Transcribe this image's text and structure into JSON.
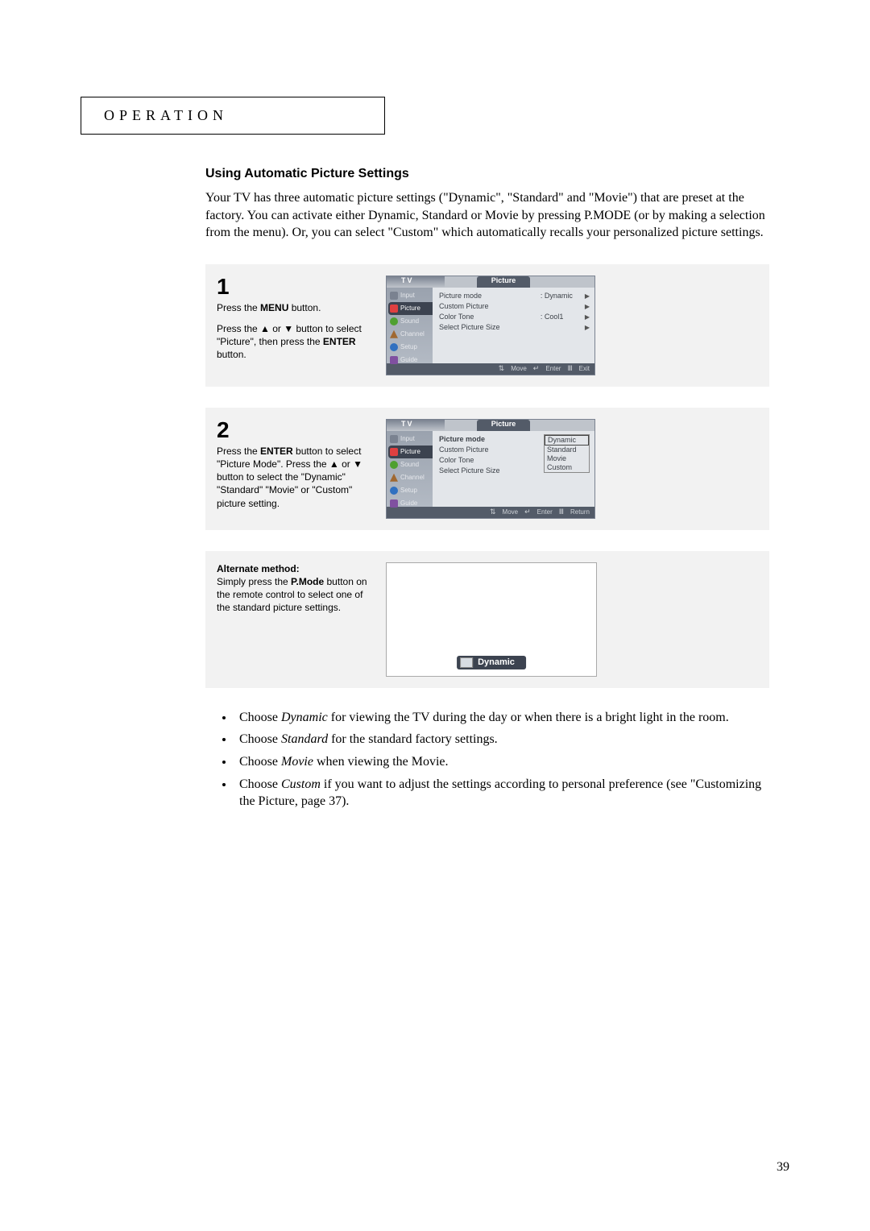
{
  "header": {
    "title": "OPERATION"
  },
  "section": {
    "heading": "Using Automatic Picture Settings"
  },
  "intro": "Your TV has three automatic picture settings (\"Dynamic\", \"Standard\" and \"Movie\") that are preset at the factory. You can activate either Dynamic, Standard or Movie by pressing P.MODE (or by making a selection from the menu). Or, you can select \"Custom\" which automatically recalls your personalized picture settings.",
  "step1": {
    "num": "1",
    "line1a": "Press the ",
    "line1b": "MENU",
    "line1c": " button.",
    "line2a": "Press the ▲ or ▼ button to select \"Picture\", then press the ",
    "line2b": "ENTER",
    "line2c": " button."
  },
  "step2": {
    "num": "2",
    "line1a": "Press the ",
    "line1b": "ENTER",
    "line1c": " button to select \"Picture Mode\". Press the ▲ or ▼ button to select the \"Dynamic\" \"Standard\" \"Movie\" or \"Custom\" picture setting."
  },
  "alt": {
    "title": "Alternate method:",
    "body1": "Simply press the ",
    "bodyb": "P.Mode",
    "body2": " button on the remote control to select one of the standard picture settings."
  },
  "pmode_label": "Dynamic",
  "osd_common": {
    "tv": "TV",
    "tab": "Picture",
    "sidebar": [
      "Input",
      "Picture",
      "Sound",
      "Channel",
      "Setup",
      "Guide"
    ]
  },
  "osd1": {
    "rows": [
      {
        "label": "Picture mode",
        "val": ": Dynamic",
        "arrow": "▶"
      },
      {
        "label": "Custom Picture",
        "val": "",
        "arrow": "▶"
      },
      {
        "label": "Color Tone",
        "val": ": Cool1",
        "arrow": "▶"
      },
      {
        "label": "Select Picture Size",
        "val": "",
        "arrow": "▶"
      }
    ],
    "footer": [
      "Move",
      "Enter",
      "Exit"
    ]
  },
  "osd2": {
    "rows": [
      {
        "label": "Picture mode",
        "bold": true
      },
      {
        "label": "Custom Picture"
      },
      {
        "label": "Color Tone"
      },
      {
        "label": "Select Picture Size"
      }
    ],
    "dropdown": [
      "Dynamic",
      "Standard",
      "Movie",
      "Custom"
    ],
    "footer": [
      "Move",
      "Enter",
      "Return"
    ]
  },
  "bullets": {
    "b1a": "Choose ",
    "b1i": "Dynamic",
    "b1b": " for viewing the TV during the day or when there is a bright light in the room.",
    "b2a": "Choose ",
    "b2i": "Standard",
    "b2b": " for the standard factory settings.",
    "b3a": "Choose ",
    "b3i": "Movie",
    "b3b": " when viewing the Movie.",
    "b4a": "Choose ",
    "b4i": "Custom",
    "b4b": " if you want to adjust the settings according to personal preference (see \"Customizing the Picture, page 37)."
  },
  "page_number": "39"
}
